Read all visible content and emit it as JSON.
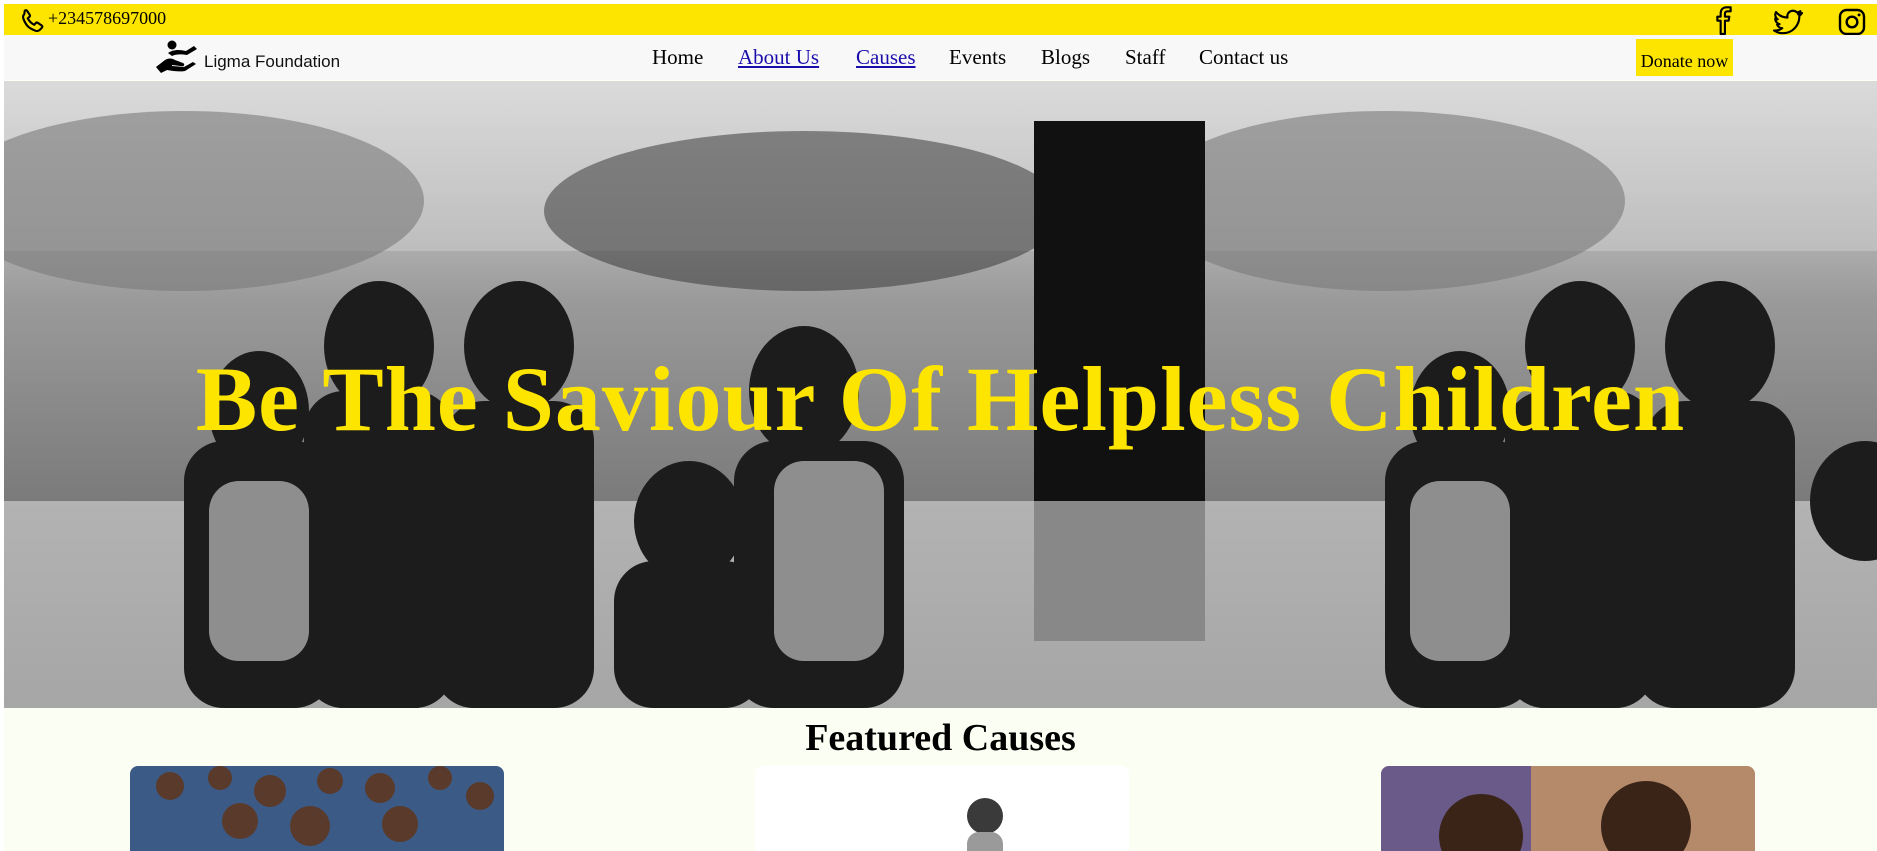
{
  "topbar": {
    "phone": "+234578697000",
    "social": [
      "facebook-icon",
      "twitter-icon",
      "instagram-icon"
    ]
  },
  "brand": {
    "name": "Ligma Foundation"
  },
  "nav": {
    "items": [
      {
        "label": "Home"
      },
      {
        "label": "About Us"
      },
      {
        "label": "Causes"
      },
      {
        "label": "Events"
      },
      {
        "label": "Blogs"
      },
      {
        "label": "Staff"
      },
      {
        "label": "Contact us"
      }
    ],
    "donate_label": "Donate now"
  },
  "hero": {
    "title": "Be The Saviour Of Helpless Children"
  },
  "featured": {
    "title": "Featured Causes"
  },
  "colors": {
    "accent": "#fde500",
    "background": "#fbfef3",
    "link": "#1a0dab"
  }
}
